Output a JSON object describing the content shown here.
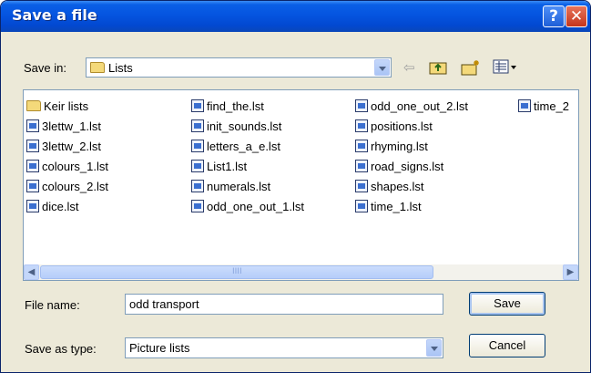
{
  "window": {
    "title": "Save a file",
    "help_glyph": "?",
    "close_glyph": "✕"
  },
  "save_in": {
    "label": "Save in:",
    "value": "Lists"
  },
  "toolbar": {
    "back_icon": "back-arrow-icon",
    "up_icon": "up-folder-icon",
    "new_folder_icon": "new-folder-icon",
    "view_menu_icon": "view-menu-icon"
  },
  "files": {
    "col1": [
      "Keir lists",
      "3lettw_1.lst",
      "3lettw_2.lst",
      "colours_1.lst",
      "colours_2.lst",
      "dice.lst"
    ],
    "col2": [
      "find_the.lst",
      "init_sounds.lst",
      "letters_a_e.lst",
      "List1.lst",
      "numerals.lst",
      "odd_one_out_1.lst"
    ],
    "col3": [
      "odd_one_out_2.lst",
      "positions.lst",
      "rhyming.lst",
      "road_signs.lst",
      "shapes.lst",
      "time_1.lst"
    ],
    "col4": [
      "time_2"
    ]
  },
  "scrollbar": {
    "left_glyph": "◀",
    "right_glyph": "▶",
    "grip_glyph": "IIII"
  },
  "file_name": {
    "label": "File name:",
    "value": "odd transport"
  },
  "save_as_type": {
    "label": "Save as type:",
    "value": "Picture lists"
  },
  "buttons": {
    "save": "Save",
    "cancel": "Cancel"
  },
  "colors": {
    "title_bar": "#0554e0",
    "dialog_bg": "#ece9d8",
    "close_button": "#c4351c",
    "border_blue": "#7f9db9"
  }
}
